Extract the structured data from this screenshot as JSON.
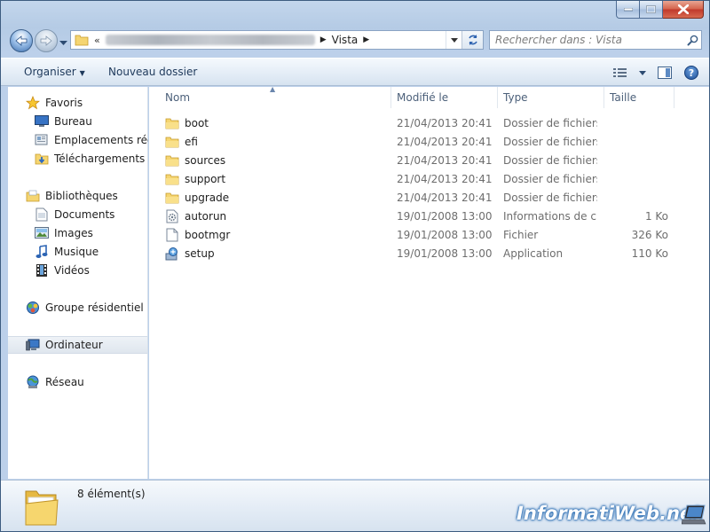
{
  "window": {
    "address": {
      "overflow_chevron": "«",
      "current_segment": "Vista"
    },
    "search": {
      "placeholder": "Rechercher dans : Vista"
    }
  },
  "toolbar": {
    "organiser_label": "Organiser",
    "new_folder_label": "Nouveau dossier"
  },
  "sidebar": {
    "favorites": {
      "label": "Favoris",
      "items": [
        {
          "label": "Bureau",
          "icon": "desktop-icon"
        },
        {
          "label": "Emplacements récen",
          "icon": "recent-places-icon"
        },
        {
          "label": "Téléchargements",
          "icon": "downloads-icon"
        }
      ]
    },
    "libraries": {
      "label": "Bibliothèques",
      "items": [
        {
          "label": "Documents",
          "icon": "documents-icon"
        },
        {
          "label": "Images",
          "icon": "pictures-icon"
        },
        {
          "label": "Musique",
          "icon": "music-icon"
        },
        {
          "label": "Vidéos",
          "icon": "videos-icon"
        }
      ]
    },
    "homegroup": {
      "label": "Groupe résidentiel"
    },
    "computer": {
      "label": "Ordinateur"
    },
    "network": {
      "label": "Réseau"
    }
  },
  "columns": {
    "name": "Nom",
    "modified": "Modifié le",
    "type": "Type",
    "size": "Taille"
  },
  "files": [
    {
      "name": "boot",
      "modified": "21/04/2013 20:41",
      "type": "Dossier de fichiers",
      "size": "",
      "icon": "folder-icon"
    },
    {
      "name": "efi",
      "modified": "21/04/2013 20:41",
      "type": "Dossier de fichiers",
      "size": "",
      "icon": "folder-icon"
    },
    {
      "name": "sources",
      "modified": "21/04/2013 20:41",
      "type": "Dossier de fichiers",
      "size": "",
      "icon": "folder-icon"
    },
    {
      "name": "support",
      "modified": "21/04/2013 20:41",
      "type": "Dossier de fichiers",
      "size": "",
      "icon": "folder-icon"
    },
    {
      "name": "upgrade",
      "modified": "21/04/2013 20:41",
      "type": "Dossier de fichiers",
      "size": "",
      "icon": "folder-icon"
    },
    {
      "name": "autorun",
      "modified": "19/01/2008 13:00",
      "type": "Informations de c...",
      "size": "1 Ko",
      "icon": "setup-info-icon"
    },
    {
      "name": "bootmgr",
      "modified": "19/01/2008 13:00",
      "type": "Fichier",
      "size": "326 Ko",
      "icon": "file-icon"
    },
    {
      "name": "setup",
      "modified": "19/01/2008 13:00",
      "type": "Application",
      "size": "110 Ko",
      "icon": "setup-app-icon"
    }
  ],
  "status": {
    "item_count": "8 élément(s)"
  },
  "watermark": {
    "text": "InformatiWeb.net"
  }
}
